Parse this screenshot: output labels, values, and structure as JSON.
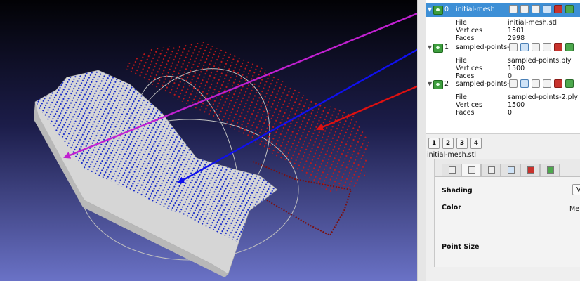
{
  "layers": [
    {
      "index": "0",
      "name": "initial-mesh",
      "selected": true,
      "props": [
        {
          "k": "File",
          "v": "initial-mesh.stl"
        },
        {
          "k": "Vertices",
          "v": "1501"
        },
        {
          "k": "Faces",
          "v": "2998"
        }
      ]
    },
    {
      "index": "1",
      "name": "sampled-points-1",
      "selected": false,
      "props": [
        {
          "k": "File",
          "v": "sampled-points.ply"
        },
        {
          "k": "Vertices",
          "v": "1500"
        },
        {
          "k": "Faces",
          "v": "0"
        }
      ]
    },
    {
      "index": "2",
      "name": "sampled-points-2",
      "selected": false,
      "props": [
        {
          "k": "File",
          "v": "sampled-points-2.ply"
        },
        {
          "k": "Vertices",
          "v": "1500"
        },
        {
          "k": "Faces",
          "v": "0"
        }
      ]
    }
  ],
  "view_tabs": [
    "1",
    "2",
    "3",
    "4"
  ],
  "current_mesh_name": "initial-mesh.stl",
  "decorator": {
    "shading_label": "Shading",
    "shading_value": "Ver",
    "color_label": "Color",
    "color_value": "Me",
    "point_size_label": "Point Size"
  },
  "icons": {
    "visibility": "eye-icon",
    "expand": "expand-arrow-icon",
    "render_modes": [
      "box-icon",
      "points-icon",
      "wireframe-icon",
      "flat-icon",
      "red-texture-icon",
      "green-texture-icon"
    ]
  },
  "colors": {
    "selection": "#3d8fd6",
    "mesh_arrow": "#c020d0",
    "points1_arrow": "#1010ee",
    "points2_arrow": "#e01010",
    "mesh_points": "#1428c8",
    "points2": "#c81818",
    "mesh_surface": "#d6d6d6"
  }
}
